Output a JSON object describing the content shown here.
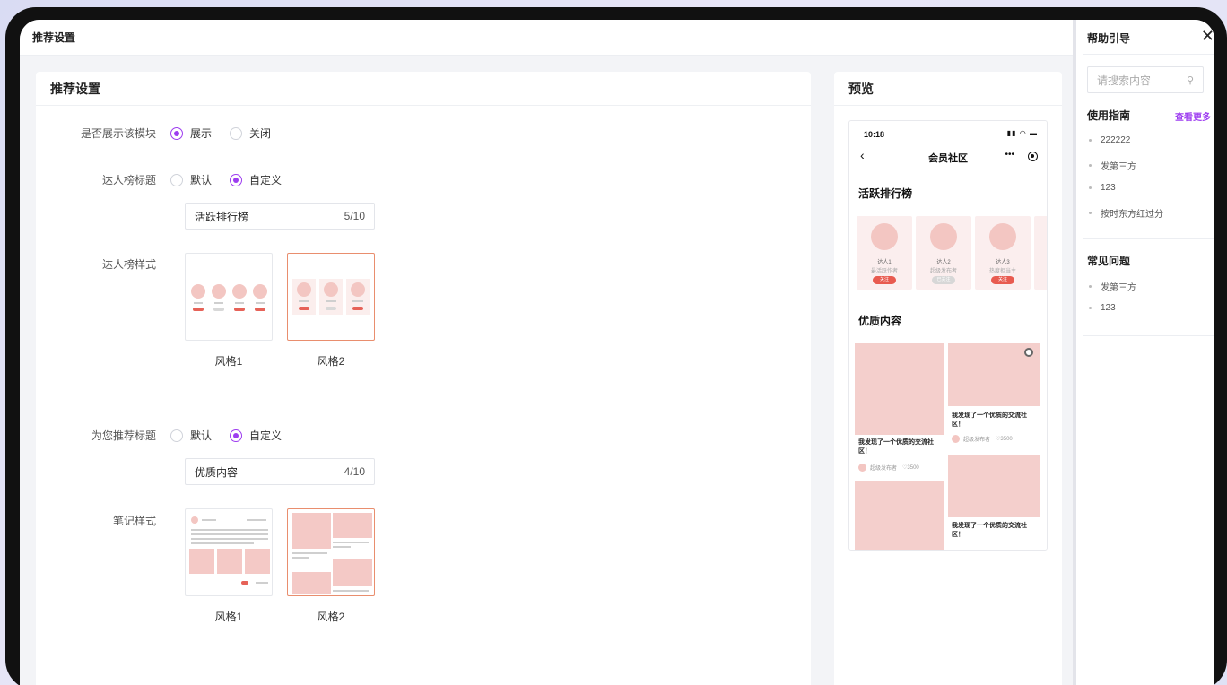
{
  "window_title": "推荐设置",
  "settings": {
    "card_title": "推荐设置",
    "show_module": {
      "label": "是否展示该模块",
      "options": [
        "展示",
        "关闭"
      ],
      "selected": 0
    },
    "talent_title": {
      "label": "达人榜标题",
      "options": [
        "默认",
        "自定义"
      ],
      "selected": 1,
      "value": "活跃排行榜",
      "count": "5/10"
    },
    "talent_style": {
      "label": "达人榜样式",
      "options": [
        "风格1",
        "风格2"
      ],
      "selected": 1
    },
    "recommend_title": {
      "label": "为您推荐标题",
      "options": [
        "默认",
        "自定义"
      ],
      "selected": 1,
      "value": "优质内容",
      "count": "4/10"
    },
    "note_style": {
      "label": "笔记样式",
      "options": [
        "风格1",
        "风格2"
      ],
      "selected": 1
    }
  },
  "preview": {
    "card_title": "预览",
    "time": "10:18",
    "status_icons": "signal-wifi-battery",
    "nav_title": "会员社区",
    "nav_more": "•••",
    "section_talent": "活跃排行榜",
    "talents": [
      {
        "name": "达人1",
        "desc": "最活跃作者",
        "btn": "关注",
        "followed": false
      },
      {
        "name": "达人2",
        "desc": "超级发布者",
        "btn": "已关注",
        "followed": true
      },
      {
        "name": "达人3",
        "desc": "热度担当主",
        "btn": "关注",
        "followed": false
      }
    ],
    "section_feed": "优质内容",
    "feed_text": "我发现了一个优质的交流社区！",
    "feed_author": "超级发布者",
    "feed_likes": "3500"
  },
  "help": {
    "title": "帮助引导",
    "close_icon": "close-icon",
    "search_placeholder": "请搜索内容",
    "guide_title": "使用指南",
    "guide_more": "查看更多",
    "guide_items": [
      "222222",
      "发第三方",
      "123",
      "按时东方红过分"
    ],
    "faq_title": "常见问题",
    "faq_items": [
      "发第三方",
      "123"
    ]
  },
  "colors": {
    "accent": "#9d3cf0",
    "selected_border": "#e98e6e",
    "pink": "#f4cfcc",
    "red": "#e85b50"
  }
}
